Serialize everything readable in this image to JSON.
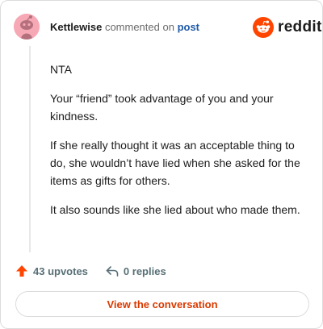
{
  "comment": {
    "username": "Kettlewise",
    "action_text": "commented on",
    "post_link": "post",
    "paragraphs": [
      "NTA",
      "Your “friend” took advantage of you and your kindness.",
      "If she really thought it was an acceptable thing to do, she wouldn’t have lied when she asked for the items as gifts for others.",
      "It also sounds like she lied about who made them."
    ]
  },
  "brand": {
    "wordmark": "reddit",
    "color": "#ff4500"
  },
  "stats": {
    "upvotes_label": "43 upvotes",
    "replies_label": "0 replies"
  },
  "cta": {
    "label": "View the conversation"
  },
  "icons": {
    "avatar": "snoo-avatar-icon",
    "brand": "reddit-logo-icon",
    "upvote": "upvote-arrow-icon",
    "reply": "reply-arrow-icon"
  }
}
